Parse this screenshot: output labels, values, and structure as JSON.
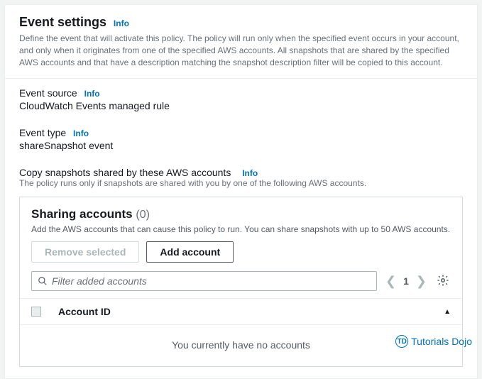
{
  "header": {
    "title": "Event settings",
    "info": "Info",
    "description": "Define the event that will activate this policy. The policy will run only when the specified event occurs in your account, and only when it originates from one of the specified AWS accounts. All snapshots that are shared by the specified AWS accounts and that have a description matching the snapshot description filter will be copied to this account."
  },
  "event_source": {
    "label": "Event source",
    "info": "Info",
    "value": "CloudWatch Events managed rule"
  },
  "event_type": {
    "label": "Event type",
    "info": "Info",
    "value": "shareSnapshot event"
  },
  "copy_snapshots": {
    "label": "Copy snapshots shared by these AWS accounts",
    "info": "Info",
    "description": "The policy runs only if snapshots are shared with you by one of the following AWS accounts."
  },
  "sharing": {
    "title": "Sharing accounts",
    "count": "(0)",
    "description": "Add the AWS accounts that can cause this policy to run. You can share snapshots with up to 50 AWS accounts.",
    "remove_label": "Remove selected",
    "add_label": "Add account",
    "search_placeholder": "Filter added accounts",
    "page_number": "1",
    "column_header": "Account ID",
    "empty_message": "You currently have no accounts"
  },
  "watermark": {
    "badge": "TD",
    "text": "Tutorials Dojo"
  }
}
